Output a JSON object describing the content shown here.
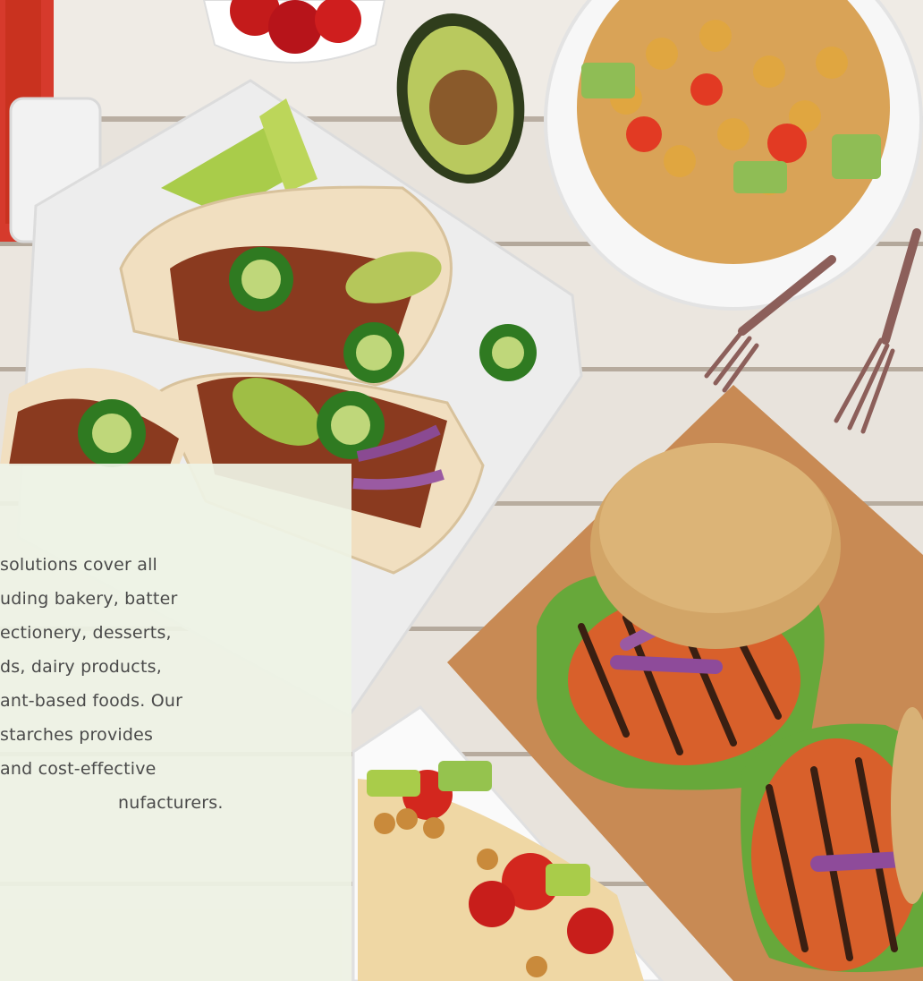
{
  "panel": {
    "lines": [
      "solutions cover all",
      "uding bakery, batter",
      "ectionery, desserts,",
      "ds, dairy products,",
      "ant-based foods. Our",
      "starches provides",
      "and cost-effective",
      "nufacturers."
    ]
  },
  "colors": {
    "panel_bg": "#eef3e5",
    "text": "#4a4a4a",
    "wood": "#e9e4dd"
  }
}
